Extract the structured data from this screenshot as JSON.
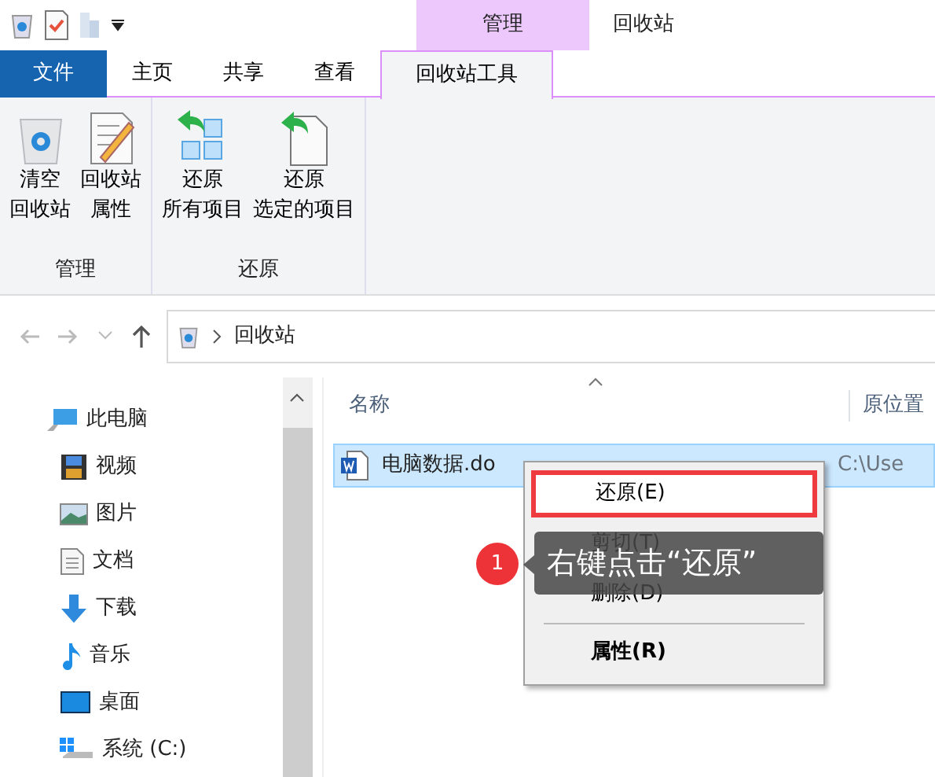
{
  "window": {
    "title": "回收站",
    "context_tab": "管理"
  },
  "ribbon_tabs": [
    {
      "label": "文件",
      "kind": "file",
      "selected": false
    },
    {
      "label": "主页",
      "kind": "tab",
      "selected": false
    },
    {
      "label": "共享",
      "kind": "tab",
      "selected": false
    },
    {
      "label": "查看",
      "kind": "tab",
      "selected": false
    },
    {
      "label": "回收站工具",
      "kind": "context",
      "selected": true
    }
  ],
  "ribbon_groups": [
    {
      "label": "管理",
      "buttons": [
        {
          "lines": [
            "清空",
            "回收站"
          ]
        },
        {
          "lines": [
            "回收站",
            "属性"
          ]
        }
      ]
    },
    {
      "label": "还原",
      "buttons": [
        {
          "lines": [
            "还原",
            "所有项目"
          ]
        },
        {
          "lines": [
            "还原",
            "选定的项目"
          ]
        }
      ]
    }
  ],
  "address": {
    "path": "回收站"
  },
  "nav_items": [
    {
      "label": "此电脑",
      "children": [
        {
          "label": "视频"
        },
        {
          "label": "图片"
        },
        {
          "label": "文档"
        },
        {
          "label": "下载"
        },
        {
          "label": "音乐"
        },
        {
          "label": "桌面"
        },
        {
          "label": "系统 (C:)"
        }
      ]
    }
  ],
  "columns": [
    "名称",
    "原位置"
  ],
  "files": [
    {
      "name": "电脑数据.do",
      "location": "C:\\Use",
      "selected": true
    }
  ],
  "context_menu": [
    {
      "kind": "item",
      "label": "还原(E)",
      "highlighted": true,
      "default": false
    },
    {
      "kind": "item",
      "label": "剪切(T)",
      "highlighted": false,
      "default": false
    },
    {
      "kind": "item",
      "label": "删除(D)",
      "highlighted": false,
      "default": false
    },
    {
      "kind": "separator"
    },
    {
      "kind": "item",
      "label": "属性(R)",
      "highlighted": false,
      "default": true
    }
  ],
  "callout": {
    "number": "1",
    "text": "右键点击“还原”"
  }
}
